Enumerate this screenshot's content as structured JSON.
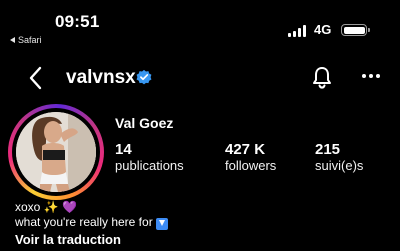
{
  "status_bar": {
    "time": "09:51",
    "back_app": "Safari",
    "network": "4G"
  },
  "header": {
    "username": "valvnsx",
    "icons": [
      "back-arrow-icon",
      "verified-badge-icon",
      "notification-bell-icon",
      "more-options-icon"
    ]
  },
  "profile": {
    "display_name": "Val Goez",
    "stats": [
      {
        "value": "14",
        "label": "publications"
      },
      {
        "value": "427 K",
        "label": "followers"
      },
      {
        "value": "215",
        "label": "suivi(e)s"
      }
    ],
    "bio_line_1": "xoxo ✨ 💜",
    "bio_line_2": "what you're really here for",
    "translate_link": "Voir la traduction"
  },
  "colors": {
    "background": "#000000",
    "verified_blue": "#3897f0",
    "text": "#ffffff"
  }
}
